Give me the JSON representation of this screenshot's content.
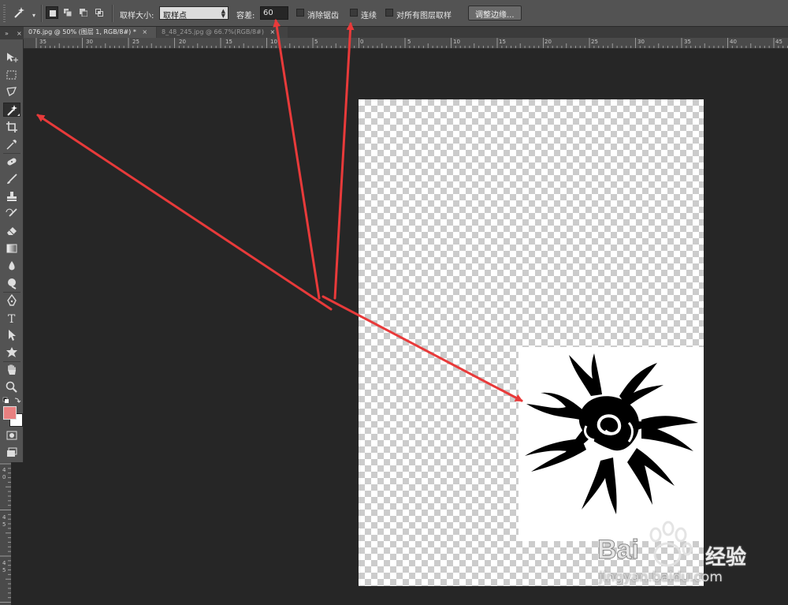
{
  "options_bar": {
    "sample_size_label": "取样大小:",
    "sample_size_value": "取样点",
    "tolerance_label": "容差:",
    "tolerance_value": "60",
    "anti_alias_label": "消除锯齿",
    "contiguous_label": "连续",
    "sample_all_layers_label": "对所有图层取样",
    "refine_edge_label": "调整边缘..."
  },
  "tabs": [
    {
      "label": "076.jpg @ 50% (图层 1, RGB/8#) *",
      "active": true
    },
    {
      "label": "8_48_245.jpg @ 66.7%(RGB/8#)",
      "active": false
    }
  ],
  "ruler_h": [
    "35",
    "30",
    "25",
    "20",
    "15",
    "10",
    "5",
    "0",
    "5",
    "10",
    "15",
    "20",
    "25",
    "30",
    "35",
    "40",
    "45"
  ],
  "ruler_v": [
    "4",
    "0",
    "4",
    "5",
    "4",
    "5"
  ],
  "watermark": {
    "brand": "Bai",
    "product": "经验",
    "url": "jingyan.baidu.com"
  },
  "colors": {
    "arrow": "#e83a3a",
    "foreground": "#e88080",
    "background": "#ffffff"
  }
}
